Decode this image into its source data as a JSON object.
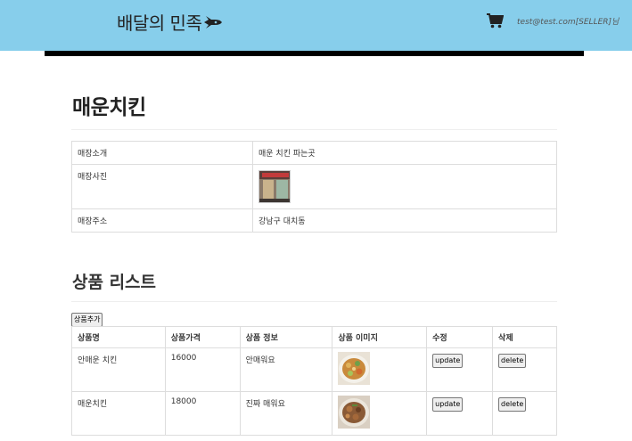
{
  "header": {
    "brand": "배달의 민족",
    "user": "test@test.com[SELLER]님"
  },
  "store": {
    "name": "매운치킨",
    "rows": [
      {
        "key": "매장소개",
        "value": "매운 치킨 파는곳"
      },
      {
        "key": "매장사진",
        "value": ""
      },
      {
        "key": "매장주소",
        "value": "강남구 대치동"
      }
    ]
  },
  "products_section": {
    "title": "상품 리스트",
    "add_label": "상품추가",
    "headers": [
      "상품명",
      "상품가격",
      "상품 정보",
      "상품 이미지",
      "수정",
      "삭제"
    ],
    "update_label": "update",
    "delete_label": "delete",
    "rows": [
      {
        "name": "안매운 치킨",
        "price": "16000",
        "info": "안매워요"
      },
      {
        "name": "매운치킨",
        "price": "18000",
        "info": "진짜 매워요"
      }
    ]
  },
  "colors": {
    "header_bg": "#87ceeb",
    "divider": "#000000"
  }
}
